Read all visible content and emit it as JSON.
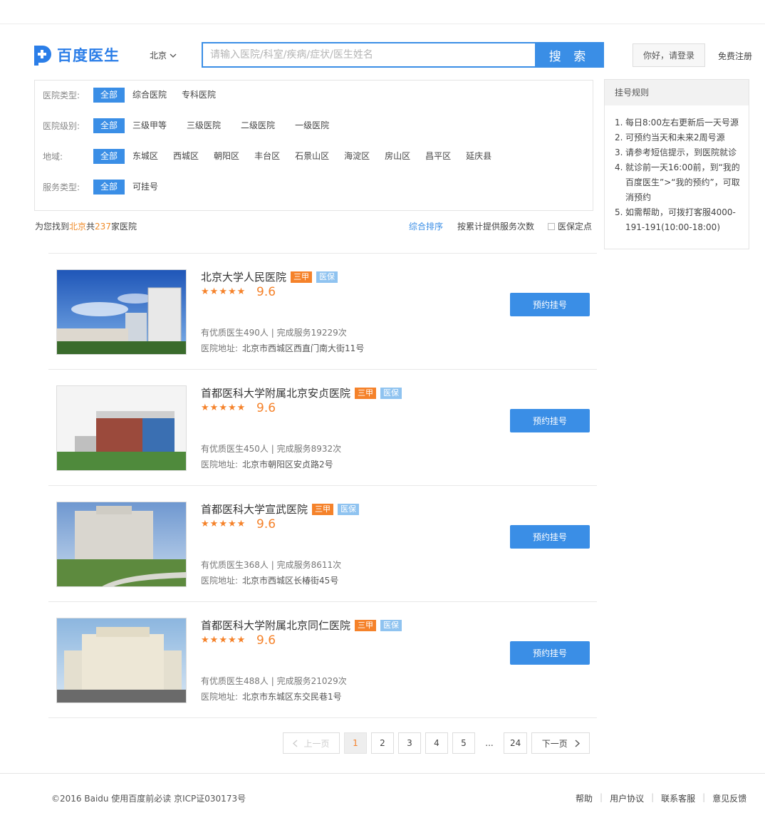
{
  "header": {
    "logo_text": "百度医生",
    "city": "北京",
    "search_placeholder": "请输入医院/科室/疾病/症状/医生姓名",
    "search_button": "搜 索",
    "login_button": "你好，请登录",
    "register_link": "免费注册"
  },
  "filters": [
    {
      "label": "医院类型:",
      "options": [
        "全部",
        "综合医院",
        "专科医院"
      ]
    },
    {
      "label": "医院级别:",
      "options": [
        "全部",
        "三级甲等",
        "三级医院",
        "二级医院",
        "一级医院"
      ]
    },
    {
      "label": "地域:",
      "options": [
        "全部",
        "东城区",
        "西城区",
        "朝阳区",
        "丰台区",
        "石景山区",
        "海淀区",
        "房山区",
        "昌平区",
        "延庆县"
      ]
    },
    {
      "label": "服务类型:",
      "options": [
        "全部",
        "可挂号"
      ]
    }
  ],
  "summary": {
    "prefix": "为您找到",
    "city": "北京",
    "mid": "共",
    "count": "237",
    "suffix": "家医院"
  },
  "sort": {
    "option1": "综合排序",
    "option2": "按累计提供服务次数",
    "option3": "医保定点"
  },
  "sidebar": {
    "title": "挂号规则",
    "rules": [
      {
        "num": "1.",
        "text": "每日8:00左右更新后一天号源"
      },
      {
        "num": "2.",
        "text": "可预约当天和未来2周号源"
      },
      {
        "num": "3.",
        "text": "请参考短信提示，到医院就诊"
      },
      {
        "num": "4.",
        "text": "就诊前一天16:00前，到“我的百度医生”>“我的预约”，可取消预约"
      },
      {
        "num": "5.",
        "text": "如需帮助，可拨打客服4000-191-191(10:00-18:00)"
      }
    ]
  },
  "hospitals": [
    {
      "name": "北京大学人民医院",
      "level": "三甲",
      "insurance": "医保",
      "rating": 5,
      "score": "9.6",
      "stats": "有优质医生490人 | 完成服务19229次",
      "addr_label": "医院地址:",
      "address": "北京市西城区西直门南大街11号",
      "button": "预约挂号"
    },
    {
      "name": "首都医科大学附属北京安贞医院",
      "level": "三甲",
      "insurance": "医保",
      "rating": 5,
      "score": "9.6",
      "stats": "有优质医生450人 | 完成服务8932次",
      "addr_label": "医院地址:",
      "address": "北京市朝阳区安贞路2号",
      "button": "预约挂号"
    },
    {
      "name": "首都医科大学宣武医院",
      "level": "三甲",
      "insurance": "医保",
      "rating": 5,
      "score": "9.6",
      "stats": "有优质医生368人 | 完成服务8611次",
      "addr_label": "医院地址:",
      "address": "北京市西城区长椿街45号",
      "button": "预约挂号"
    },
    {
      "name": "首都医科大学附属北京同仁医院",
      "level": "三甲",
      "insurance": "医保",
      "rating": 5,
      "score": "9.6",
      "stats": "有优质医生488人 | 完成服务21029次",
      "addr_label": "医院地址:",
      "address": "北京市东城区东交民巷1号",
      "button": "预约挂号"
    }
  ],
  "pagination": {
    "prev": "上一页",
    "pages": [
      "1",
      "2",
      "3",
      "4",
      "5"
    ],
    "ellipsis": "...",
    "last": "24",
    "next": "下一页",
    "current": "1"
  },
  "footer": {
    "copyright": "©2016 Baidu 使用百度前必读  京ICP证030173号",
    "links": [
      "帮助",
      "用户协议",
      "联系客服",
      "意见反馈"
    ]
  },
  "colors": {
    "accent": "#3a8ee6",
    "orange": "#f5822a",
    "insurance_tag": "#8fc3f0"
  }
}
